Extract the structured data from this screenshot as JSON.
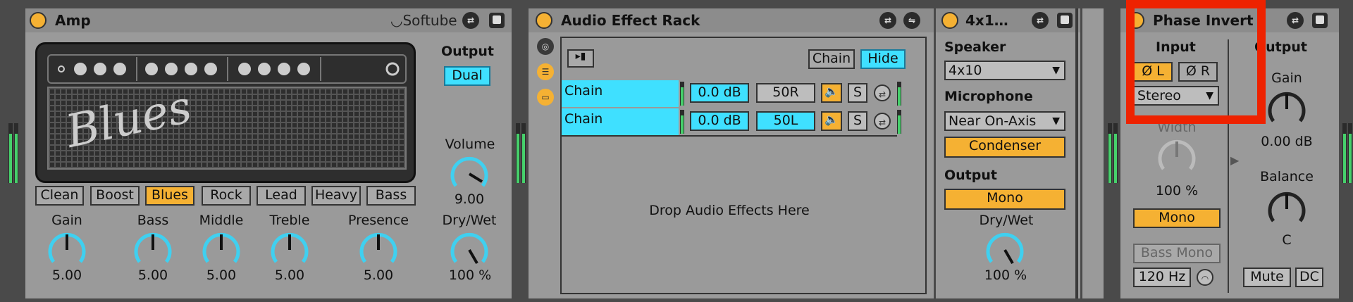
{
  "amp": {
    "title": "Amp",
    "brand": "Softube",
    "output_label": "Output",
    "output_mode": "Dual",
    "amp_script": "Blues",
    "models": [
      "Clean",
      "Boost",
      "Blues",
      "Rock",
      "Lead",
      "Heavy",
      "Bass"
    ],
    "selected_model": "Blues",
    "knobs": [
      {
        "label": "Gain",
        "value": "5.00"
      },
      {
        "label": "Bass",
        "value": "5.00"
      },
      {
        "label": "Middle",
        "value": "5.00"
      },
      {
        "label": "Treble",
        "value": "5.00"
      },
      {
        "label": "Presence",
        "value": "5.00"
      }
    ],
    "volume": {
      "label": "Volume",
      "value": "9.00"
    },
    "drywet": {
      "label": "Dry/Wet",
      "value": "100 %"
    }
  },
  "rack": {
    "title": "Audio Effect Rack",
    "chain_toggle": "Chain",
    "hide_toggle": "Hide",
    "chains": [
      {
        "name": "Chain",
        "volume": "0.0 dB",
        "pan": "50R",
        "solo": "S"
      },
      {
        "name": "Chain",
        "volume": "0.0 dB",
        "pan": "50L",
        "solo": "S"
      }
    ],
    "drop_hint": "Drop Audio Effects Here"
  },
  "cab": {
    "title": "4x1…",
    "speaker_label": "Speaker",
    "speaker_value": "4x10",
    "microphone_label": "Microphone",
    "microphone_value": "Near On-Axis",
    "mic_type": "Condenser",
    "output_label": "Output",
    "output_mode": "Mono",
    "drywet": {
      "label": "Dry/Wet",
      "value": "100 %"
    }
  },
  "utility": {
    "title": "Phase Invert",
    "input_label": "Input",
    "phase_left": "Ø L",
    "phase_right": "Ø R",
    "channel_mode": "Stereo",
    "width": {
      "label": "Width",
      "value": "100 %"
    },
    "mono_button": "Mono",
    "bass_mono": "Bass Mono",
    "bass_mono_freq": "120 Hz",
    "output_label": "Output",
    "gain": {
      "label": "Gain",
      "value": "0.00 dB"
    },
    "balance": {
      "label": "Balance",
      "value": "C"
    },
    "mute": "Mute",
    "dc": "DC"
  },
  "colors": {
    "accent": "#f5b133",
    "selection": "#3fe0ff",
    "highlight_box": "#ee2200",
    "panel": "#9a9a9a"
  }
}
